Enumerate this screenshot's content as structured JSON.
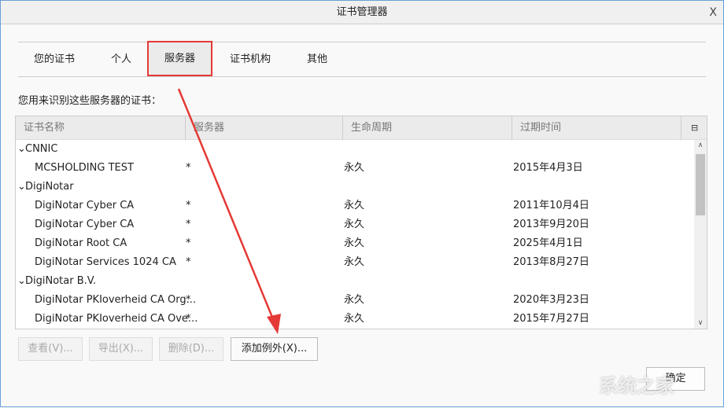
{
  "window": {
    "title": "证书管理器",
    "close": "X"
  },
  "tabs": [
    "您的证书",
    "个人",
    "服务器",
    "证书机构",
    "其他"
  ],
  "label": "您用来识别这些服务器的证书：",
  "columns": [
    "证书名称",
    "服务器",
    "生命周期",
    "过期时间"
  ],
  "rows": [
    {
      "type": "group",
      "name": "CNNIC"
    },
    {
      "name": "MCSHOLDING TEST",
      "server": "*",
      "life": "永久",
      "expires": "2015年4月3日"
    },
    {
      "type": "group",
      "name": "DigiNotar"
    },
    {
      "name": "DigiNotar Cyber CA",
      "server": "*",
      "life": "永久",
      "expires": "2011年10月4日"
    },
    {
      "name": "DigiNotar Cyber CA",
      "server": "*",
      "life": "永久",
      "expires": "2013年9月20日"
    },
    {
      "name": "DigiNotar Root CA",
      "server": "*",
      "life": "永久",
      "expires": "2025年4月1日"
    },
    {
      "name": "DigiNotar Services 1024 CA",
      "server": "*",
      "life": "永久",
      "expires": "2013年8月27日"
    },
    {
      "type": "group",
      "name": "DigiNotar B.V."
    },
    {
      "name": "DigiNotar PKIoverheid CA Org...",
      "server": "*",
      "life": "永久",
      "expires": "2020年3月23日"
    },
    {
      "name": "DigiNotar PKIoverheid CA Ove...",
      "server": "*",
      "life": "永久",
      "expires": "2015年7月27日"
    }
  ],
  "buttons": {
    "view": "查看(V)...",
    "export": "导出(X)...",
    "delete": "删除(D)...",
    "add_exception": "添加例外(X)...",
    "ok": "确定"
  },
  "watermark": "系统之家",
  "colors": {
    "highlight": "#e53935"
  }
}
